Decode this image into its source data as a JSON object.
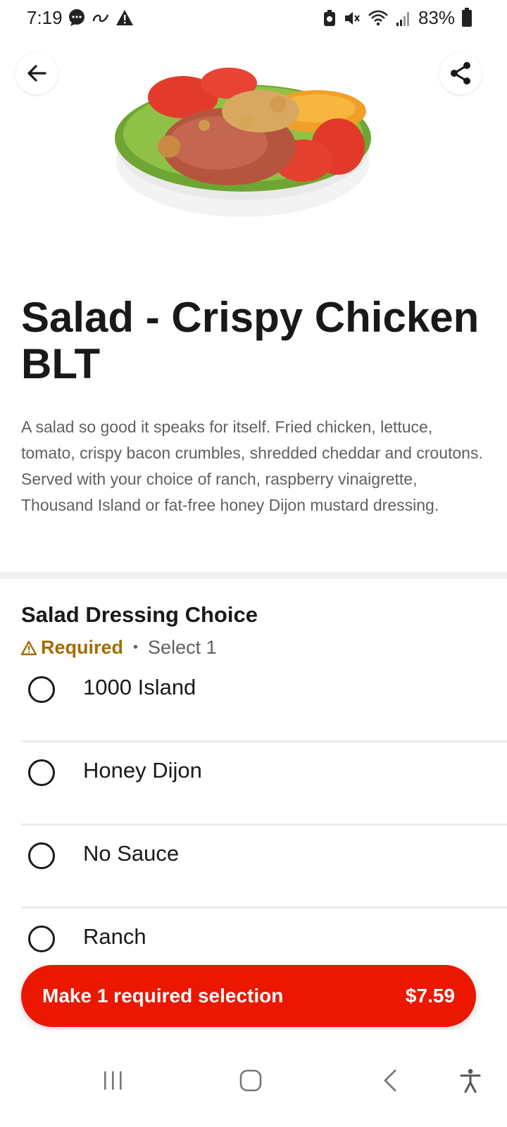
{
  "status_bar": {
    "time": "7:19",
    "battery": "83%"
  },
  "item": {
    "title": "Salad - Crispy Chicken BLT",
    "description": "A salad so good it speaks for itself. Fried chicken, lettuce, tomato, crispy bacon crumbles, shredded cheddar and croutons. Served with your choice of ranch, raspberry vinaigrette, Thousand Island or fat-free honey Dijon mustard dressing."
  },
  "option_group": {
    "title": "Salad Dressing Choice",
    "required_label": "Required",
    "select_label": "Select 1",
    "options": [
      {
        "label": "1000 Island"
      },
      {
        "label": "Honey Dijon"
      },
      {
        "label": "No Sauce"
      },
      {
        "label": "Ranch"
      }
    ]
  },
  "cta": {
    "label": "Make 1 required selection",
    "price": "$7.59"
  },
  "colors": {
    "accent": "#eb1700",
    "required": "#a16c00"
  },
  "icons": {
    "back": "arrow-left-icon",
    "share": "share-icon",
    "warning": "warning-icon"
  }
}
